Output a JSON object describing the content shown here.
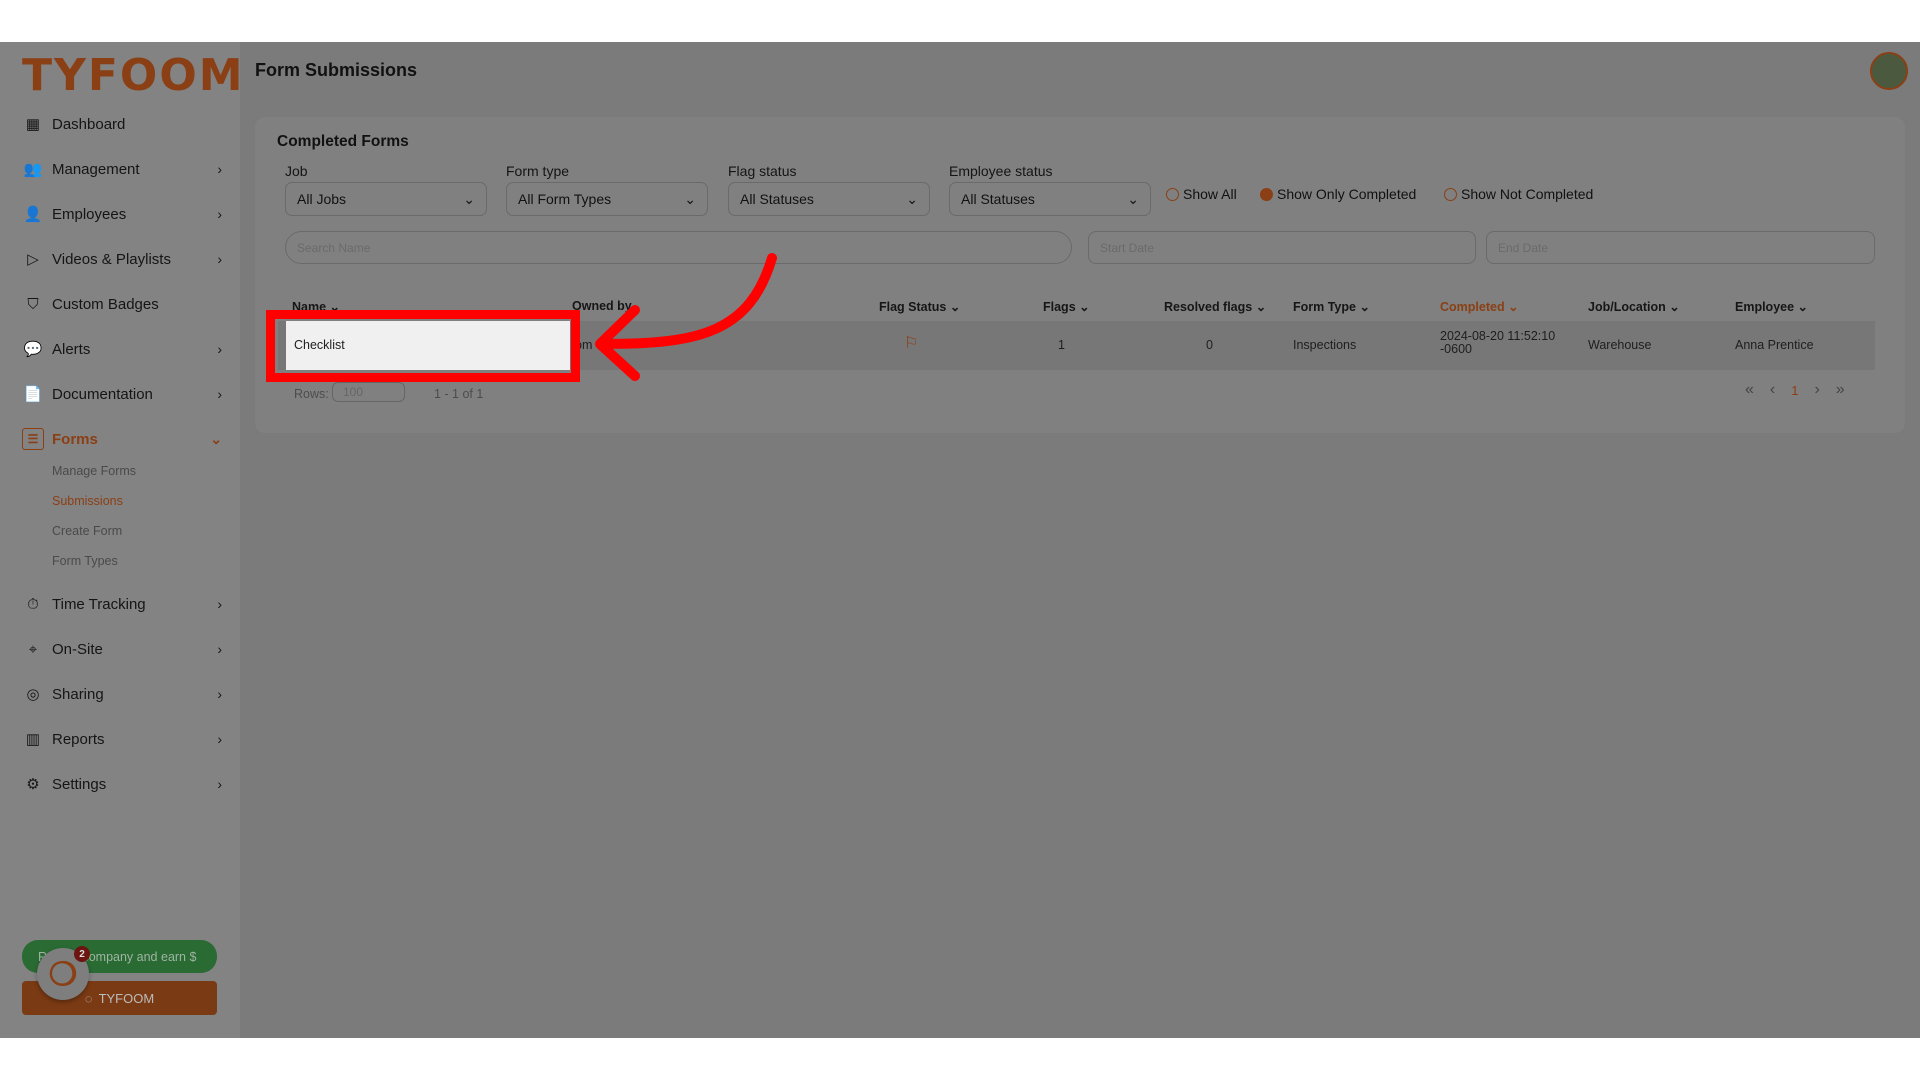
{
  "brand": {
    "logo": "TYFOOM",
    "accent": "#8a3f14"
  },
  "header": {
    "title": "Form Submissions"
  },
  "sidebar": {
    "items": [
      {
        "label": "Dashboard",
        "icon": "dashboard-icon"
      },
      {
        "label": "Management",
        "icon": "users-icon"
      },
      {
        "label": "Employees",
        "icon": "user-icon"
      },
      {
        "label": "Videos & Playlists",
        "icon": "play-icon"
      },
      {
        "label": "Custom Badges",
        "icon": "badge-icon"
      },
      {
        "label": "Alerts",
        "icon": "chat-icon"
      },
      {
        "label": "Documentation",
        "icon": "document-icon"
      },
      {
        "label": "Forms",
        "icon": "list-icon"
      },
      {
        "label": "Time Tracking",
        "icon": "stopwatch-icon"
      },
      {
        "label": "On-Site",
        "icon": "location-icon"
      },
      {
        "label": "Sharing",
        "icon": "share-icon"
      },
      {
        "label": "Reports",
        "icon": "bar-chart-icon"
      },
      {
        "label": "Settings",
        "icon": "gear-icon"
      }
    ],
    "forms_sub": [
      "Manage Forms",
      "Submissions",
      "Create Form",
      "Form Types"
    ],
    "refer": "Refer a company and earn $",
    "refer_visible": "company and earn $",
    "tyfoom_button": "TYFOOM",
    "badge_count": "2"
  },
  "card": {
    "title": "Completed Forms",
    "filters": [
      {
        "label": "Job",
        "value": "All Jobs"
      },
      {
        "label": "Form type",
        "value": "All Form Types"
      },
      {
        "label": "Flag status",
        "value": "All Statuses"
      },
      {
        "label": "Employee status",
        "value": "All Statuses"
      }
    ],
    "radios": [
      {
        "label": "Show All",
        "checked": false
      },
      {
        "label": "Show Only Completed",
        "checked": true
      },
      {
        "label": "Show Not Completed",
        "checked": false
      }
    ],
    "search_placeholder": "Search Name",
    "start_placeholder": "Start Date",
    "end_placeholder": "End Date"
  },
  "table": {
    "columns": [
      "Name",
      "Owned by",
      "Flag Status",
      "Flags",
      "Resolved flags",
      "Form Type",
      "Completed",
      "Job/Location",
      "Employee"
    ],
    "rows": [
      {
        "name": "Checklist",
        "owned": "om",
        "flags": "1",
        "resolved": "0",
        "form_type": "Inspections",
        "completed": "2024-08-20 11:52:10",
        "completed2": "-0600",
        "job": "Warehouse",
        "employee": "Anna Prentice"
      }
    ],
    "rows_label": "Rows:",
    "rows_value": "100",
    "range": "1 - 1 of 1",
    "page": "1"
  }
}
